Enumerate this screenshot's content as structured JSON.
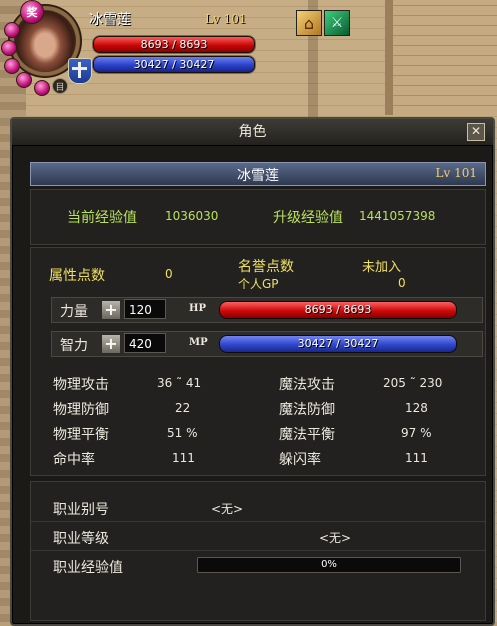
{
  "hud": {
    "level_orb": "奖",
    "small_orb": "目",
    "name": "冰雪莲",
    "level": "Lv 101",
    "hp_text": "8693 / 8693",
    "mp_text": "30427 / 30427"
  },
  "window": {
    "title": "角色",
    "close": "✕",
    "char_name": "冰雪莲",
    "char_level": "Lv 101"
  },
  "exp": {
    "current_label": "当前经验值",
    "current_value": "1036030",
    "next_label": "升级经验值",
    "next_value": "1441057398"
  },
  "points": {
    "attr_label": "属性点数",
    "attr_value": "0",
    "honor_label": "名誉点数",
    "honor_value": "未加入",
    "gp_label": "个人GP",
    "gp_value": "0"
  },
  "strength": {
    "label": "力量",
    "plus": "+",
    "value": "120",
    "bar_label": "HP",
    "bar_text": "8693 / 8693"
  },
  "intellect": {
    "label": "智力",
    "plus": "+",
    "value": "420",
    "bar_label": "MP",
    "bar_text": "30427 / 30427"
  },
  "stats": {
    "phys_atk_label": "物理攻击",
    "phys_atk_value": "36 ˜ 41",
    "mag_atk_label": "魔法攻击",
    "mag_atk_value": "205 ˜ 230",
    "phys_def_label": "物理防御",
    "phys_def_value": "22",
    "mag_def_label": "魔法防御",
    "mag_def_value": "128",
    "phys_bal_label": "物理平衡",
    "phys_bal_value": "51 %",
    "mag_bal_label": "魔法平衡",
    "mag_bal_value": "97 %",
    "hit_label": "命中率",
    "hit_value": "111",
    "dodge_label": "躲闪率",
    "dodge_value": "111"
  },
  "job": {
    "alias_label": "职业别号",
    "alias_value": "<无>",
    "level_label": "职业等级",
    "level_value": "<无>",
    "exp_label": "职业经验值",
    "exp_value": "0%",
    "exp_fraction": 0.0
  }
}
